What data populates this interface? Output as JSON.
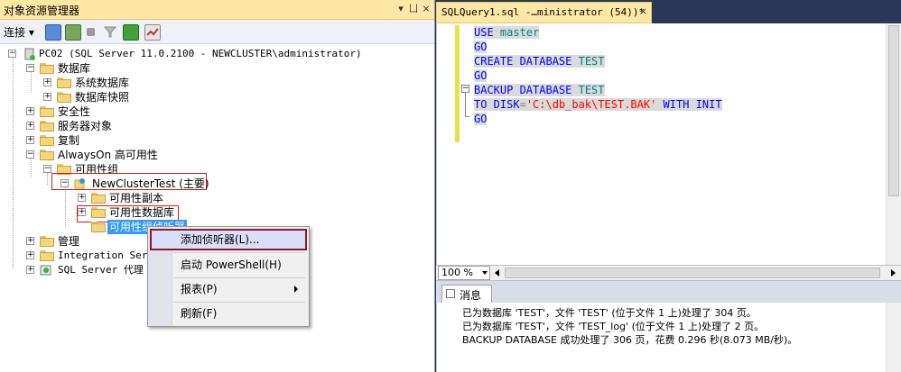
{
  "object_explorer": {
    "title": "对象资源管理器",
    "title_buttons": [
      "▾",
      "ㄩ",
      "×"
    ],
    "toolbar": {
      "connect_label": "连接"
    },
    "tree": {
      "server": "PC02 (SQL Server 11.0.2100 - NEWCLUSTER\\administrator)",
      "databases": "数据库",
      "system_databases": "系统数据库",
      "db_snapshots": "数据库快照",
      "security": "安全性",
      "server_objects": "服务器对象",
      "replication": "复制",
      "alwayson": "AlwaysOn 高可用性",
      "availability_groups": "可用性组",
      "group_name": "NewClusterTest (主要)",
      "replicas": "可用性副本",
      "av_databases": "可用性数据库",
      "listeners": "可用性组侦听器",
      "management": "管理",
      "integration": "Integration Servi",
      "agent": "SQL Server 代理"
    }
  },
  "context_menu": {
    "items": [
      {
        "label": "添加侦听器(L)..."
      },
      {
        "label": "启动 PowerShell(H)"
      },
      {
        "label": "报表(P)"
      },
      {
        "label": "刷新(F)"
      }
    ]
  },
  "editor": {
    "tab_title": "SQLQuery1.sql -…ministrator (54))*",
    "tab_close": "×",
    "lines": [
      {
        "kw": "USE",
        "rest": "master"
      },
      {
        "kw": "GO",
        "rest": ""
      },
      {
        "kw": "CREATE DATABASE",
        "rest": "TEST"
      },
      {
        "kw": "GO",
        "rest": ""
      },
      {
        "kw": "BACKUP DATABASE",
        "rest": "TEST"
      },
      {
        "kw": "TO DISK",
        "op": "=",
        "str": "'C:\\db_bak\\TEST.BAK'",
        "kw2": "WITH INIT"
      },
      {
        "kw": "GO",
        "rest": ""
      }
    ],
    "zoom": "100 %"
  },
  "messages": {
    "tab_label": "消息",
    "lines": [
      "已为数据库 'TEST'，文件 'TEST' (位于文件 1 上)处理了 304 页。",
      "已为数据库 'TEST'，文件 'TEST_log' (位于文件 1 上)处理了 2 页。",
      "BACKUP DATABASE 成功处理了 306 页，花费 0.296 秒(8.073 MB/秒)。"
    ]
  }
}
